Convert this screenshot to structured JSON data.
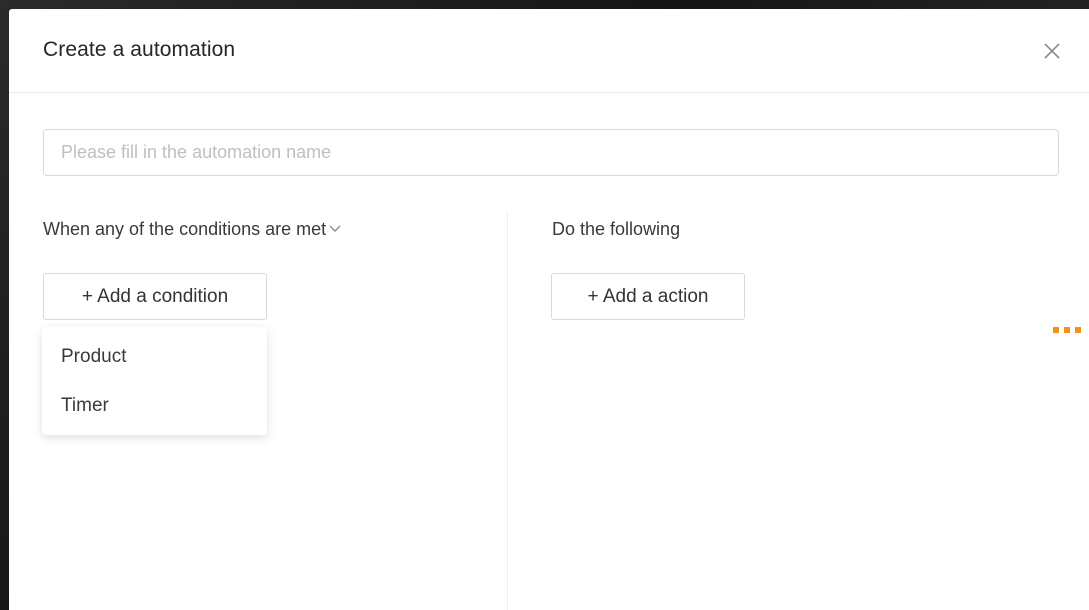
{
  "modal": {
    "title": "Create a automation",
    "close_icon": "close-icon"
  },
  "name_input": {
    "value": "",
    "placeholder": "Please fill in the automation name"
  },
  "conditions": {
    "heading": "When any of the conditions are met",
    "heading_icon": "chevron-down-icon",
    "add_button_label": "+ Add a condition",
    "dropdown_items": [
      "Product",
      "Timer"
    ]
  },
  "actions": {
    "heading": "Do the following",
    "add_button_label": "+ Add a action"
  },
  "colors": {
    "accent_loading": "#f5901f",
    "border": "#d9d9d9",
    "placeholder": "#bfbfbf"
  }
}
